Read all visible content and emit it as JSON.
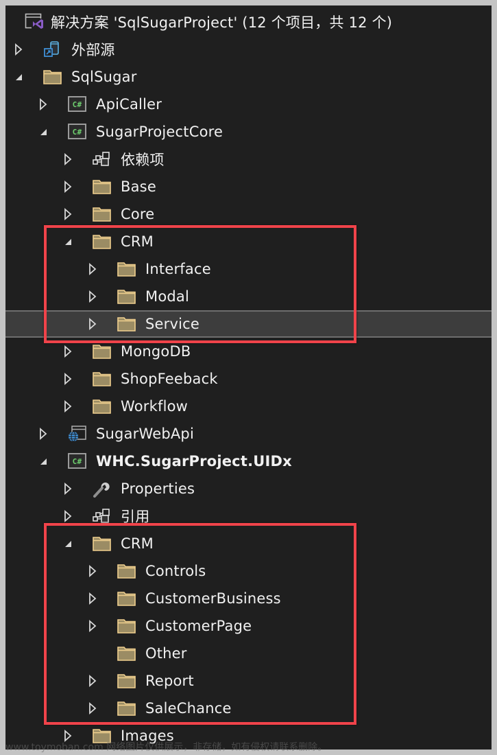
{
  "solution": {
    "title": "解决方案 'SqlSugarProject' (12 个项目，共 12 个)",
    "icon": "visual-studio-solution-icon"
  },
  "tree": [
    {
      "id": "external-sources",
      "label": "外部源",
      "depth": 0,
      "expander": "collapsed",
      "icon": "external-sources-icon"
    },
    {
      "id": "sqlsugar",
      "label": "SqlSugar",
      "depth": 0,
      "expander": "expanded",
      "icon": "folder-icon"
    },
    {
      "id": "apicaller",
      "label": "ApiCaller",
      "depth": 1,
      "expander": "collapsed",
      "icon": "csharp-project-icon"
    },
    {
      "id": "sugarprojectcore",
      "label": "SugarProjectCore",
      "depth": 1,
      "expander": "expanded",
      "icon": "csharp-project-icon"
    },
    {
      "id": "dependencies",
      "label": "依赖项",
      "depth": 2,
      "expander": "collapsed",
      "icon": "dependencies-icon"
    },
    {
      "id": "base",
      "label": "Base",
      "depth": 2,
      "expander": "collapsed",
      "icon": "folder-icon"
    },
    {
      "id": "core",
      "label": "Core",
      "depth": 2,
      "expander": "collapsed",
      "icon": "folder-icon"
    },
    {
      "id": "crm-core",
      "label": "CRM",
      "depth": 2,
      "expander": "expanded",
      "icon": "folder-icon"
    },
    {
      "id": "interface",
      "label": "Interface",
      "depth": 3,
      "expander": "collapsed",
      "icon": "folder-icon"
    },
    {
      "id": "modal",
      "label": "Modal",
      "depth": 3,
      "expander": "collapsed",
      "icon": "folder-icon"
    },
    {
      "id": "service",
      "label": "Service",
      "depth": 3,
      "expander": "collapsed",
      "icon": "folder-icon",
      "selected": true
    },
    {
      "id": "mongodb",
      "label": "MongoDB",
      "depth": 2,
      "expander": "collapsed",
      "icon": "folder-icon"
    },
    {
      "id": "shopfeeback",
      "label": "ShopFeeback",
      "depth": 2,
      "expander": "collapsed",
      "icon": "folder-icon"
    },
    {
      "id": "workflow",
      "label": "Workflow",
      "depth": 2,
      "expander": "collapsed",
      "icon": "folder-icon"
    },
    {
      "id": "sugarwebapi",
      "label": "SugarWebApi",
      "depth": 1,
      "expander": "collapsed",
      "icon": "web-project-icon"
    },
    {
      "id": "whc-uidx",
      "label": "WHC.SugarProject.UIDx",
      "depth": 1,
      "expander": "expanded",
      "icon": "csharp-project-icon",
      "bold": true
    },
    {
      "id": "properties",
      "label": "Properties",
      "depth": 2,
      "expander": "collapsed",
      "icon": "wrench-icon"
    },
    {
      "id": "references",
      "label": "引用",
      "depth": 2,
      "expander": "collapsed",
      "icon": "dependencies-icon"
    },
    {
      "id": "crm-ui",
      "label": "CRM",
      "depth": 2,
      "expander": "expanded",
      "icon": "folder-icon"
    },
    {
      "id": "controls",
      "label": "Controls",
      "depth": 3,
      "expander": "collapsed",
      "icon": "folder-icon"
    },
    {
      "id": "customerbusiness",
      "label": "CustomerBusiness",
      "depth": 3,
      "expander": "collapsed",
      "icon": "folder-icon"
    },
    {
      "id": "customerpage",
      "label": "CustomerPage",
      "depth": 3,
      "expander": "collapsed",
      "icon": "folder-icon"
    },
    {
      "id": "other",
      "label": "Other",
      "depth": 3,
      "expander": "none",
      "icon": "folder-icon"
    },
    {
      "id": "report",
      "label": "Report",
      "depth": 3,
      "expander": "collapsed",
      "icon": "folder-icon"
    },
    {
      "id": "salechance",
      "label": "SaleChance",
      "depth": 3,
      "expander": "collapsed",
      "icon": "folder-icon"
    },
    {
      "id": "images",
      "label": "Images",
      "depth": 2,
      "expander": "collapsed",
      "icon": "folder-icon"
    }
  ],
  "highlights": [
    {
      "name": "highlight-box-core-crm",
      "covers": [
        "crm-core",
        "interface",
        "modal",
        "service"
      ]
    },
    {
      "name": "highlight-box-ui-crm",
      "covers": [
        "crm-ui",
        "controls",
        "customerbusiness",
        "customerpage",
        "other",
        "report",
        "salechance"
      ]
    }
  ],
  "colors": {
    "background": "#1f1f1f",
    "text": "#f1f1f1",
    "selected_row": "#3d3d3d",
    "folder": "#9b8c64",
    "folder_border": "#f0cf8e",
    "csharp_green": "#6fd16f",
    "highlight_red": "#f0434a",
    "vs_purple": "#8a5cc6",
    "link_blue": "#4fa3e8"
  },
  "watermark": "www.toymoban.com 网络图片仅供展示，非存储，如有侵权请联系删除。"
}
